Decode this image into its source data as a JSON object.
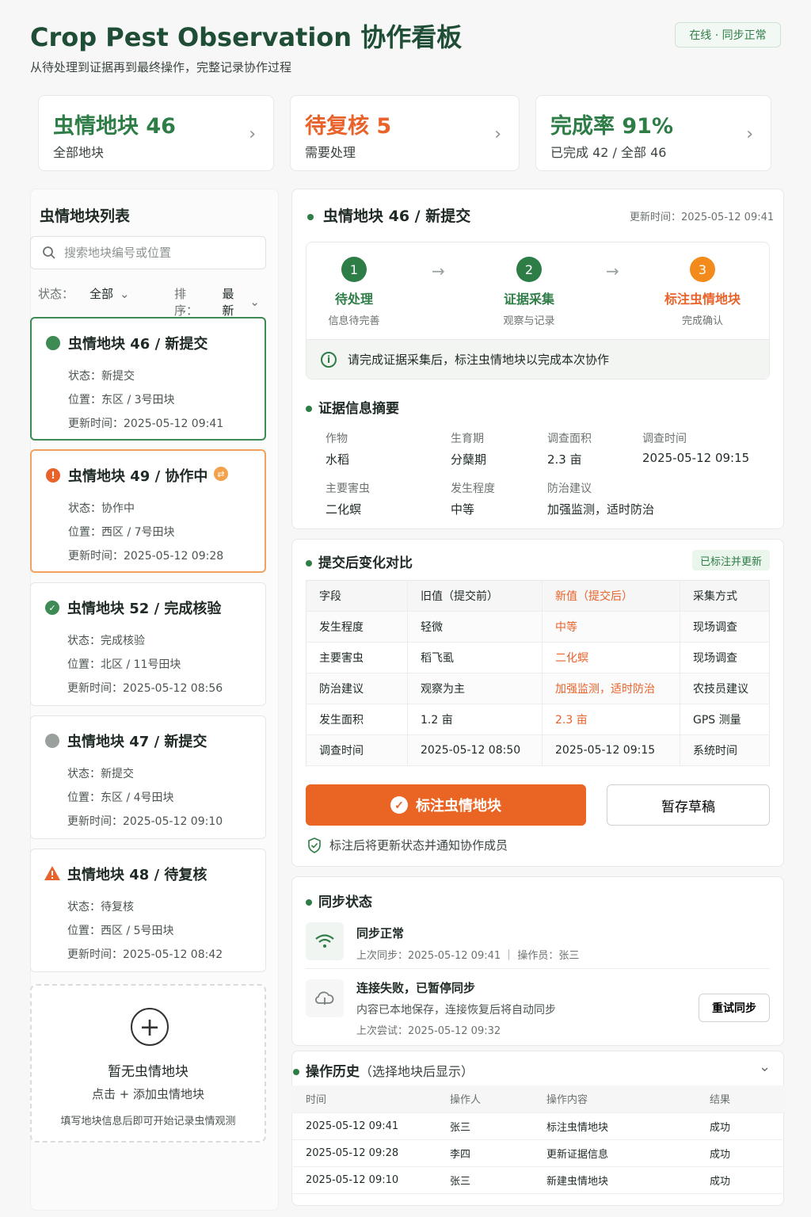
{
  "header": {
    "title": "Crop Pest Observation 协作看板",
    "subtitle": "从待处理到证据再到最终操作，完整记录协作过程",
    "status_pill": "在线 · 同步正常"
  },
  "stats": [
    {
      "big": "虫情地块  46",
      "sub": "全部地块",
      "color": "#2e7d46"
    },
    {
      "big": "待复核  5",
      "sub": "需要处理",
      "color": "#e8622a"
    },
    {
      "big": "完成率  91%",
      "sub": "已完成 42 / 全部 46",
      "color": "#2e7d46"
    }
  ],
  "sidebar": {
    "title": "虫情地块列表",
    "search_placeholder": "搜索地块编号或位置",
    "filter_status_label": "状态：",
    "filter_status_value": "全部",
    "sort_label": "排序：",
    "sort_value": "最新",
    "items": [
      {
        "title": "虫情地块 46 / 新提交",
        "status": "状态：新提交",
        "location": "位置：东区 / 3号田块",
        "updated": "更新时间：2025-05-12 09:41"
      },
      {
        "title": "虫情地块 49 / 协作中",
        "status": "状态：协作中",
        "location": "位置：西区 / 7号田块",
        "updated": "更新时间：2025-05-12 09:28"
      },
      {
        "title": "虫情地块 52 / 完成核验",
        "status": "状态：完成核验",
        "location": "位置：北区 / 11号田块",
        "updated": "更新时间：2025-05-12 08:56"
      },
      {
        "title": "虫情地块 47 / 新提交",
        "status": "状态：新提交",
        "location": "位置：东区 / 4号田块",
        "updated": "更新时间：2025-05-12 09:10"
      },
      {
        "title": "虫情地块 48 / 待复核",
        "status": "状态：待复核",
        "location": "位置：西区 / 5号田块",
        "updated": "更新时间：2025-05-12 08:42"
      }
    ],
    "empty": {
      "title": "暂无虫情地块",
      "hint": "点击 + 添加虫情地块",
      "desc": "填写地块信息后即可开始记录虫情观测"
    }
  },
  "detail": {
    "title": "虫情地块 46 / 新提交",
    "updated": "更新时间：2025-05-12 09:41",
    "steps": [
      {
        "num": "1",
        "label": "待处理",
        "desc": "信息待完善"
      },
      {
        "num": "2",
        "label": "证据采集",
        "desc": "观察与记录"
      },
      {
        "num": "3",
        "label": "标注虫情地块",
        "desc": "完成确认"
      }
    ],
    "tip": "请完成证据采集后，标注虫情地块以完成本次协作",
    "summary_title": "证据信息摘要",
    "summary": [
      {
        "label": "作物",
        "value": "水稻"
      },
      {
        "label": "生育期",
        "value": "分蘖期"
      },
      {
        "label": "调查面积",
        "value": "2.3 亩"
      },
      {
        "label": "调查时间",
        "value": "2025-05-12 09:15"
      },
      {
        "label": "主要害虫",
        "value": "二化螟"
      },
      {
        "label": "发生程度",
        "value": "中等"
      },
      {
        "label": "防治建议",
        "value": "加强监测，适时防治"
      }
    ]
  },
  "compare": {
    "title": "提交后变化对比",
    "tag": "已标注并更新",
    "headers": [
      "字段",
      "旧值（提交前）",
      "新值（提交后）",
      "采集方式"
    ],
    "rows": [
      [
        "发生程度",
        "轻微",
        "中等",
        "现场调查"
      ],
      [
        "主要害虫",
        "稻飞虱",
        "二化螟",
        "现场调查"
      ],
      [
        "防治建议",
        "观察为主",
        "加强监测，适时防治",
        "农技员建议"
      ],
      [
        "发生面积",
        "1.2 亩",
        "2.3 亩",
        "GPS 测量"
      ],
      [
        "调查时间",
        "2025-05-12 08:50",
        "2025-05-12 09:15",
        "系统时间"
      ]
    ],
    "primary_button": "标注虫情地块",
    "secondary_button": "暂存草稿",
    "note": "标注后将更新状态并通知协作成员"
  },
  "sync": {
    "title": "同步状态",
    "ok_title": "同步正常",
    "ok_desc": "上次同步：2025-05-12 09:41 ｜ 操作员：张三",
    "fail_title": "连接失败，已暂停同步",
    "fail_desc": "内容已本地保存，连接恢复后将自动同步",
    "fail_last": "上次尝试：2025-05-12 09:32",
    "retry_button": "重试同步"
  },
  "history": {
    "title": "操作历史",
    "title_suffix": "（选择地块后显示）",
    "headers": [
      "时间",
      "操作人",
      "操作内容",
      "结果"
    ],
    "rows": [
      [
        "2025-05-12 09:41",
        "张三",
        "标注虫情地块",
        "成功"
      ],
      [
        "2025-05-12 09:28",
        "李四",
        "更新证据信息",
        "成功"
      ],
      [
        "2025-05-12 09:10",
        "张三",
        "新建虫情地块",
        "成功"
      ]
    ]
  },
  "colors": {
    "brand_green": "#2e7d46",
    "accent_orange": "#ea6423",
    "gray_dot": "#9aa09c"
  }
}
